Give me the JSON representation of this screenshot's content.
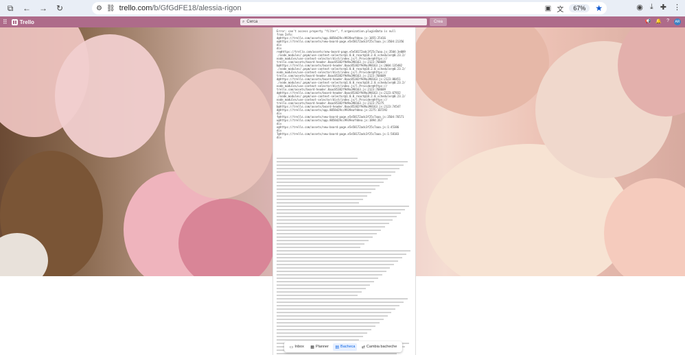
{
  "browser": {
    "url_host": "trello.com",
    "url_path": "/b/GfGdFE18/alessia-rigon",
    "zoom": "67%"
  },
  "trello": {
    "logo": "Trello",
    "search_placeholder": "Cerca",
    "create_label": "Crea"
  },
  "error": {
    "lines": [
      "Error: can't access property \"filter\", f.organization.pluginData is null",
      "from Info:",
      "d@https://trello.com/assets/app.8058d29cc9939eaf4dea.js:1855:25416",
      "o@https://trello.com/assets/new-board-page.e5e58172adc3f25c7aaa.js:3504:21356",
      "div",
      "div",
      "re@https://trello.com/assets/new-board-page.e5e58172adc3f25c7aaa.js:3504:3e009",
      "./node_modules/.pnpm/use-context-selector@1.0.0_react@18.2.0_scheduler@0.23.2/",
      "node_modules/use-context-selector/dist/index.js/l.Provider@https://",
      "trello.com/assets/board-header.8aac85382f9d9a398163.js:2123:768609",
      "b@https://trello.com/assets/board-header.8aac85382f9d9a398163.js:2004:135482",
      "./node_modules/.pnpm/use-context-selector@1.0.0_react@18.2.0_scheduler@0.23.2/",
      "node_modules/use-context-selector/dist/index.js/l.Provider@https://",
      "trello.com/assets/board-header.8aac85382f9d9a398163.js:2123:768609",
      "d@https://trello.com/assets/board-header.8aac85382f9d9a398163.js:2123:88451",
      "./node_modules/.pnpm/use-context-selector@1.0.0_react@18.2.0_scheduler@0.23.2/",
      "node_modules/use-context-selector/dist/index.js/l.Provider@https://",
      "trello.com/assets/board-header.8aac85382f9d9a398163.js:2123:768609",
      "d@https://trello.com/assets/board-header.8aac85382f9d9a398163.js:2123:67932",
      "./node_modules/.pnpm/use-context-selector@1.0.0_react@18.2.0_scheduler@0.23.2/",
      "node_modules/use-context-selector/dist/index.js/l.Provider@https://",
      "trello.com/assets/board-header.8aac85382f9d9a398163.js:2123:75275",
      "b@https://trello.com/assets/board-header.8aac85382f9d9a398163.js:2123:74547",
      "d@https://trello.com/assets/app.8058d29cc9939eaf4dea.js:2275:107292",
      "div",
      "f@https://trello.com/assets/new-board-page.e5e58172adc3f25c7aaa.js:3504:76571",
      "u@https://trello.com/assets/app.8058d29cc9939eaf4dea.js:1894:267",
      "div",
      "o@https://trello.com/assets/new-board-page.e5e58172adc3f25c7aaa.js:1:45386",
      "div",
      "T@https://trello.com/assets/new-board-page.e5e58172adc3f25c7aaa.js:1:58183",
      "div"
    ]
  },
  "bottom_nav": {
    "inbox": "Inbox",
    "planner": "Planner",
    "board": "Bacheca",
    "switch": "Cambia bacheche"
  }
}
